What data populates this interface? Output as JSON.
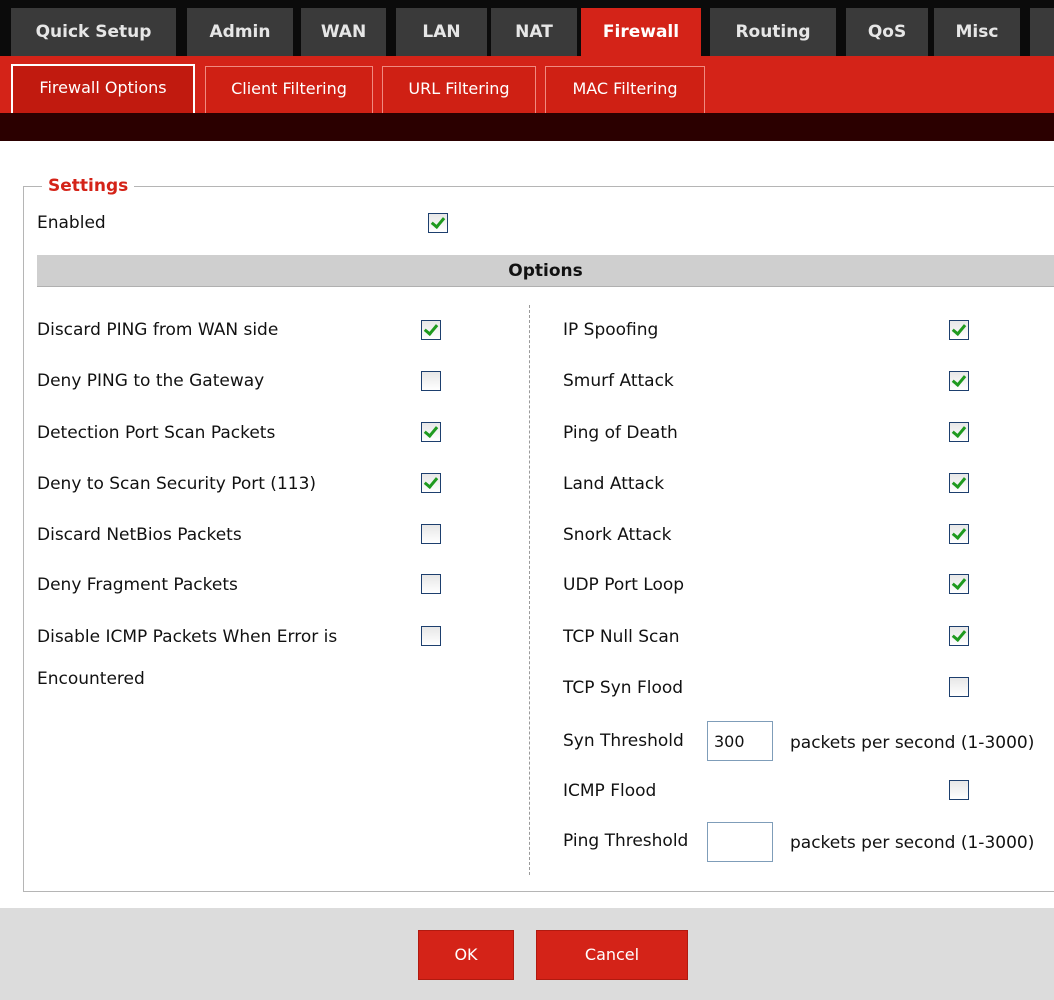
{
  "top_tabs": [
    "Quick Setup",
    "Admin",
    "WAN",
    "LAN",
    "NAT",
    "Firewall",
    "Routing",
    "QoS",
    "Misc"
  ],
  "active_top_tab": "Firewall",
  "sub_tabs": [
    "Firewall Options",
    "Client Filtering",
    "URL Filtering",
    "MAC Filtering"
  ],
  "active_sub_tab": "Firewall Options",
  "settings": {
    "legend": "Settings",
    "enabled_label": "Enabled",
    "enabled": true
  },
  "options_header": "Options",
  "left_options": [
    {
      "label": "Discard PING from WAN side",
      "checked": true
    },
    {
      "label": "Deny PING to the Gateway",
      "checked": false
    },
    {
      "label": "Detection Port Scan Packets",
      "checked": true
    },
    {
      "label": "Deny to Scan Security Port (113)",
      "checked": true
    },
    {
      "label": "Discard NetBios Packets",
      "checked": false
    },
    {
      "label": "Deny Fragment Packets",
      "checked": false
    },
    {
      "label": "Disable ICMP Packets When Error is",
      "label_line2": "Encountered",
      "checked": false
    }
  ],
  "right_options": [
    {
      "label": "IP Spoofing",
      "checked": true
    },
    {
      "label": "Smurf Attack",
      "checked": true
    },
    {
      "label": "Ping of Death",
      "checked": true
    },
    {
      "label": "Land Attack",
      "checked": true
    },
    {
      "label": "Snork Attack",
      "checked": true
    },
    {
      "label": "UDP Port Loop",
      "checked": true
    },
    {
      "label": "TCP Null Scan",
      "checked": true
    },
    {
      "label": "TCP Syn Flood",
      "checked": false
    }
  ],
  "syn_threshold": {
    "label": "Syn Threshold",
    "value": "300",
    "unit": "packets per second (1-3000)"
  },
  "icmp_flood": {
    "label": "ICMP Flood",
    "checked": false
  },
  "ping_threshold": {
    "label": "Ping Threshold",
    "value": "",
    "unit": "packets per second (1-3000)"
  },
  "buttons": {
    "ok": "OK",
    "cancel": "Cancel"
  },
  "colors": {
    "accent": "#d42318",
    "check": "#1f9a1f",
    "tab_dark": "#3a3a3a"
  }
}
